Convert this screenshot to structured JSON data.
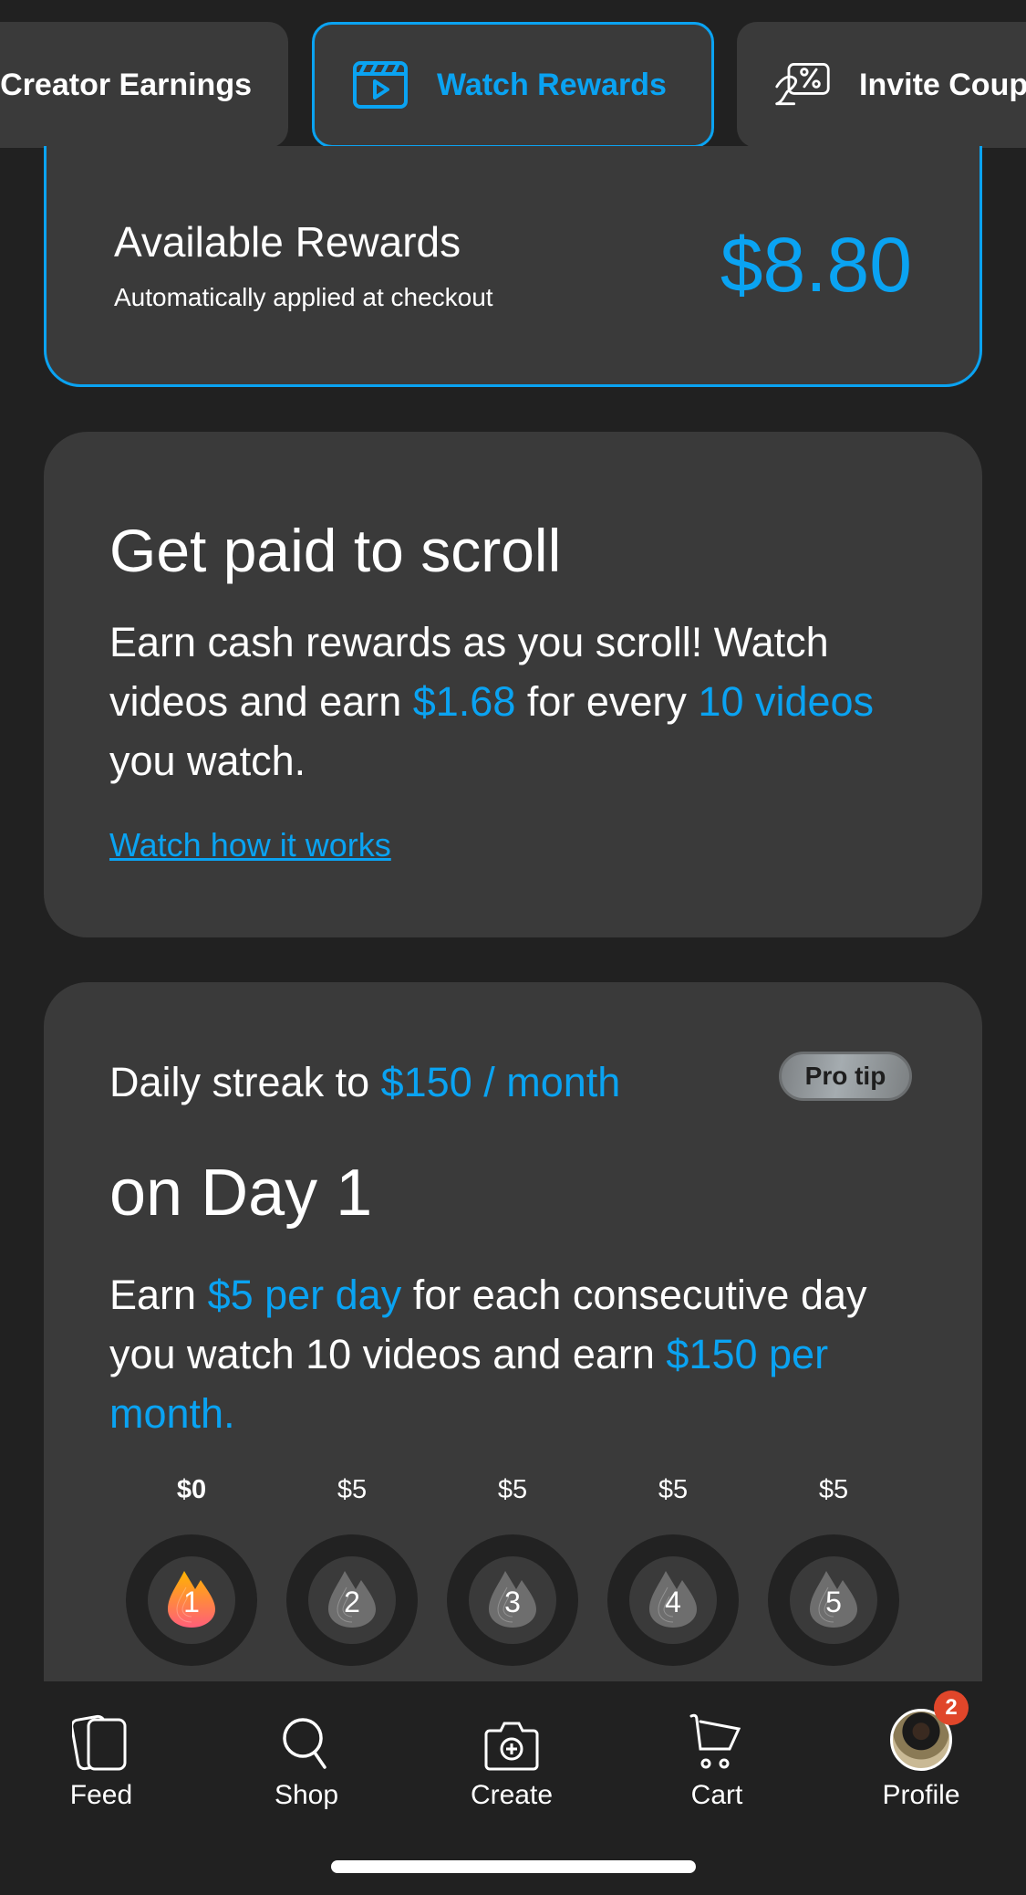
{
  "tabs": [
    {
      "label": "Creator Earnings",
      "icon": "none",
      "active": false
    },
    {
      "label": "Watch Rewards",
      "icon": "clapperboard-icon",
      "active": true
    },
    {
      "label": "Invite Coupons",
      "icon": "coupon-hand-icon",
      "active": false
    }
  ],
  "available": {
    "title": "Available Rewards",
    "subtitle": "Automatically applied at checkout",
    "amount": "$8.80"
  },
  "scroll_card": {
    "title": "Get paid to scroll",
    "body_1": "Earn cash rewards as you scroll! Watch videos and earn ",
    "amount": "$1.68",
    "body_2": " for every ",
    "count": "10 videos",
    "body_3": " you watch.",
    "link": "Watch how it works"
  },
  "streak_card": {
    "heading_1": "Daily streak to ",
    "heading_2": "$150 / month",
    "pro_tip": "Pro tip",
    "day_label": "on Day 1",
    "body_1": "Earn ",
    "body_2": "$5 per day",
    "body_3": " for each consecutive day you watch 10 videos and earn ",
    "body_4": "$150 per month.",
    "days": [
      {
        "amount": "$0",
        "number": "1",
        "active": true
      },
      {
        "amount": "$5",
        "number": "2",
        "active": false
      },
      {
        "amount": "$5",
        "number": "3",
        "active": false
      },
      {
        "amount": "$5",
        "number": "4",
        "active": false
      },
      {
        "amount": "$5",
        "number": "5",
        "active": false
      }
    ]
  },
  "nav": {
    "items": [
      {
        "label": "Feed",
        "icon": "feed-cards-icon"
      },
      {
        "label": "Shop",
        "icon": "search-icon"
      },
      {
        "label": "Create",
        "icon": "camera-plus-icon"
      },
      {
        "label": "Cart",
        "icon": "cart-icon"
      },
      {
        "label": "Profile",
        "icon": "avatar"
      }
    ],
    "profile_badge": "2"
  },
  "colors": {
    "accent": "#0aa3f2",
    "background": "#212121",
    "card": "#3a3a3a",
    "badge": "#e0462a"
  }
}
